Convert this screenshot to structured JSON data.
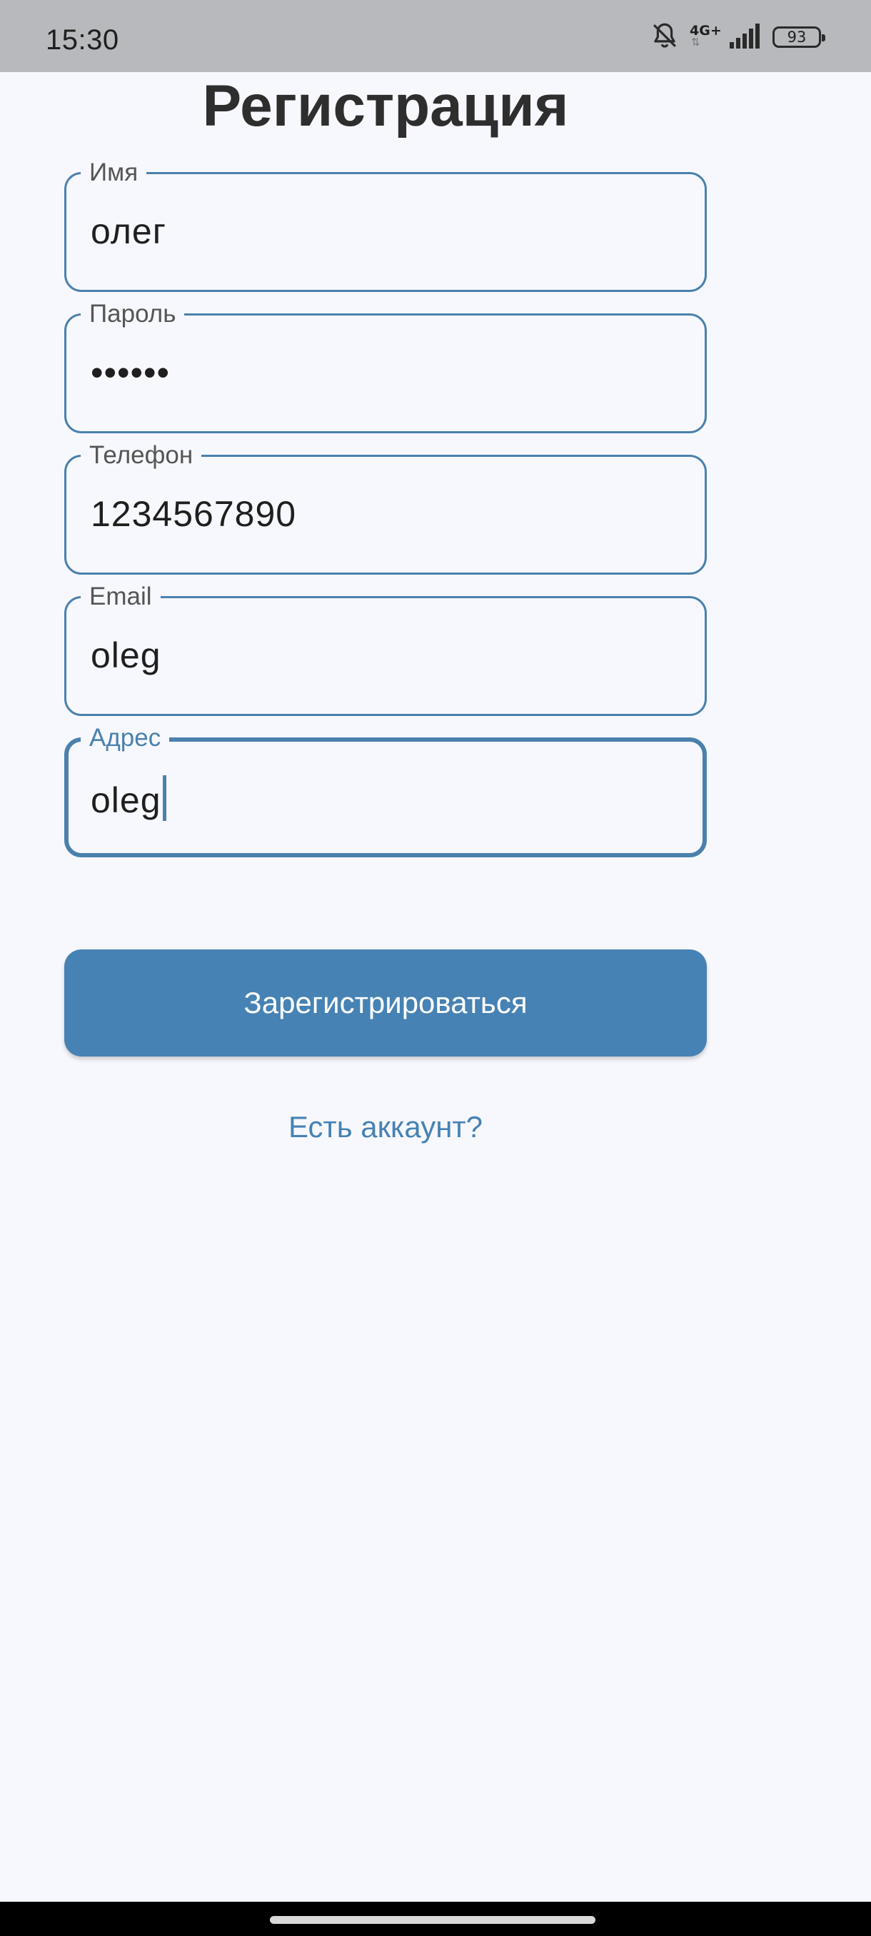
{
  "status_bar": {
    "time": "15:30",
    "network_type": "4G+",
    "battery_level": "93",
    "icons": [
      "bell-off-icon",
      "signal-icon",
      "battery-icon"
    ]
  },
  "screen": {
    "title": "Регистрация"
  },
  "form": {
    "fields": [
      {
        "label": "Имя",
        "value": "олег"
      },
      {
        "label": "Пароль",
        "value": "••••••"
      },
      {
        "label": "Телефон",
        "value": "1234567890"
      },
      {
        "label": "Email",
        "value": "oleg"
      },
      {
        "label": "Адрес",
        "value": "oleg"
      }
    ],
    "submit_label": "Зарегистрироваться",
    "login_link": "Есть аккаунт?"
  },
  "colors": {
    "accent": "#4682b4",
    "background": "#f7f8fd",
    "status_bar": "#b8b9bc"
  }
}
